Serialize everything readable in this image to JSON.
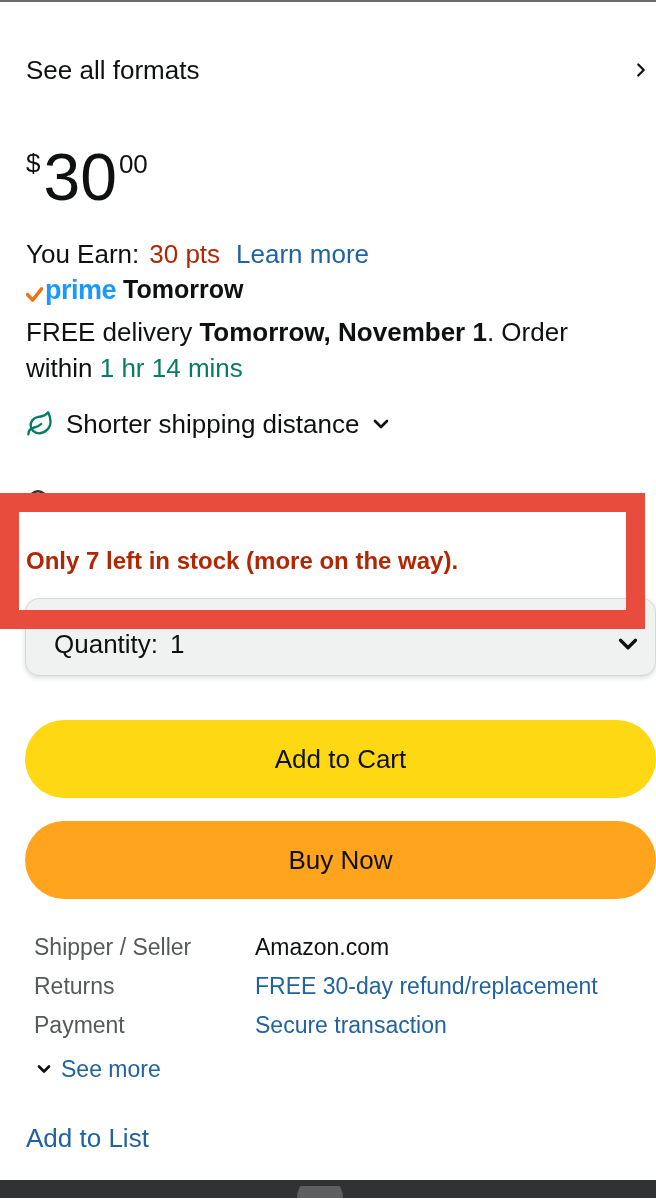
{
  "formats_link": {
    "label": "See all formats"
  },
  "price": {
    "currency": "$",
    "whole": "30",
    "fraction": "00"
  },
  "points": {
    "label": "You Earn:",
    "value": "30 pts",
    "link": "Learn more"
  },
  "prime_badge": {
    "logo": "prime",
    "label": "Tomorrow"
  },
  "delivery": {
    "text": "FREE delivery **Tomorrow, November 1**. Order within",
    "countdown": "1 hr 14 mins"
  },
  "shipping_note": {
    "label": "Shorter shipping distance",
    "expanded": false
  },
  "stock": {
    "message": "Only 7 left in stock (more on the way).",
    "highlighted": true
  },
  "quantity": {
    "label": "Quantity:",
    "value": "1"
  },
  "buttons": [
    {
      "kind": "add_to_cart",
      "label": "Add to Cart"
    },
    {
      "kind": "buy_now",
      "label": "Buy Now"
    }
  ],
  "details": [
    {
      "label": "Shipper / Seller",
      "value": "Amazon.com",
      "kind": "text"
    },
    {
      "label": "Returns",
      "value": "FREE 30-day refund/replacement",
      "kind": "link"
    },
    {
      "label": "Payment",
      "value": "Secure transaction",
      "kind": "link"
    }
  ],
  "see_more": {
    "label": "See more",
    "expanded": false
  },
  "add_to_list": {
    "label": "Add to List"
  }
}
